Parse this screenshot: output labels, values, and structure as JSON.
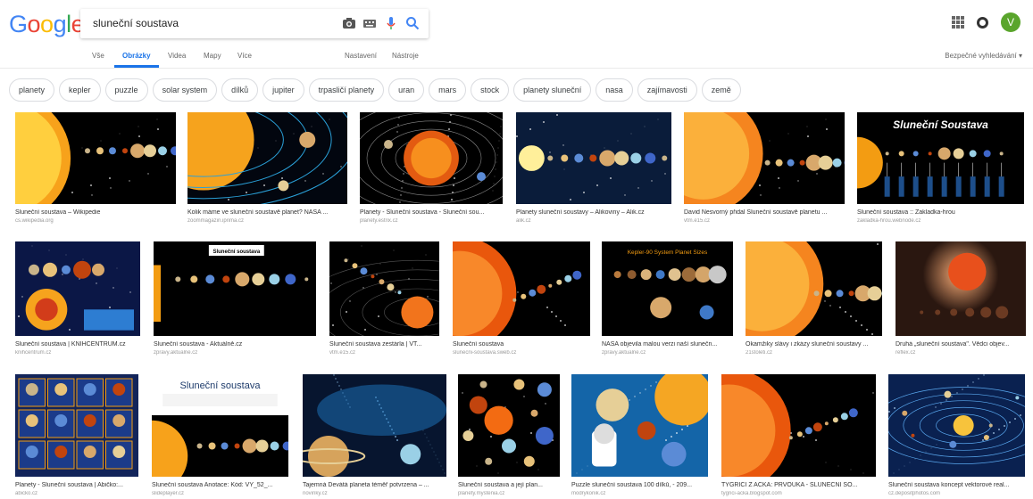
{
  "logo": {
    "letters": [
      "G",
      "o",
      "o",
      "g",
      "l",
      "e"
    ],
    "colors": [
      "#4285F4",
      "#EA4335",
      "#FBBC05",
      "#4285F4",
      "#34A853",
      "#EA4335"
    ]
  },
  "search": {
    "query": "sluneční soustava",
    "icons": [
      "camera-icon",
      "keyboard-icon",
      "microphone-icon",
      "search-icon"
    ]
  },
  "header": {
    "avatar_letter": "V",
    "accent": "#5aa52c"
  },
  "tabs": {
    "items": [
      "Vše",
      "Obrázky",
      "Videa",
      "Mapy",
      "Více"
    ],
    "active": "Obrázky",
    "settings": "Nastavení",
    "tools": "Nástroje",
    "safe_search": "Bezpečné vyhledávání ▾",
    "accent": "#1a73e8"
  },
  "chips": [
    "planety",
    "kepler",
    "puzzle",
    "solar system",
    "dílků",
    "jupiter",
    "trpasličí planety",
    "uran",
    "mars",
    "stock",
    "planety sluneční",
    "nasa",
    "zajímavosti",
    "země"
  ],
  "results": [
    {
      "title": "Sluneční soustava – Wikipedie",
      "source": "cs.wikipedia.org",
      "theme": "sun-left"
    },
    {
      "title": "Kolik máme ve sluneční soustavě planet? NASA ...",
      "source": "zoommagazin.iprima.cz",
      "theme": "sun-orbits"
    },
    {
      "title": "Planety - Sluneční soustava - Sluneční sou...",
      "source": "planety.estrix.cz",
      "theme": "sun-center"
    },
    {
      "title": "Planety sluneční soustavy – Alikoviny – Alik.cz",
      "source": "alik.cz",
      "theme": "row-planets"
    },
    {
      "title": "David Nesvorný přidal Sluneční soustavě planetu ...",
      "source": "vtm.e15.cz",
      "theme": "sun-left-big"
    },
    {
      "title": "Sluneční soustava :: Zakladka-hrou",
      "source": "zakladka-hrou.webnode.cz",
      "theme": "title-chart",
      "label": "Sluneční Soustava"
    },
    {
      "title": "Sluneční soustava | KNIHCENTRUM.cz",
      "source": "knihcentrum.cz",
      "theme": "poster"
    },
    {
      "title": "Sluneční soustava - Aktuálně.cz",
      "source": "zpravy.aktualne.cz",
      "theme": "lineup",
      "label": "Sluneční soustava"
    },
    {
      "title": "Sluneční soustava zestárla | VT...",
      "source": "vtm.e15.cz",
      "theme": "diagonal"
    },
    {
      "title": "Sluneční soustava",
      "source": "slunecni-soustava.sweb.cz",
      "theme": "sun-left-diag"
    },
    {
      "title": "NASA objevila malou verzi naší slunečn...",
      "source": "zpravy.aktualne.cz",
      "theme": "kepler",
      "label": "Kepler-90 System Planet Sizes"
    },
    {
      "title": "Okamžiky slávy i zkázy sluneční soustavy ...",
      "source": "21stoleti.cz",
      "theme": "sun-left-big"
    },
    {
      "title": "Druhá „sluneční soustava\". Vědci objev...",
      "source": "reflex.cz",
      "theme": "dark-glow"
    },
    {
      "title": "Planety - Sluneční soustava | Abičko:...",
      "source": "abicko.cz",
      "theme": "cards"
    },
    {
      "title": "Sluneční soustava Anotace: Kód: VY_52_...",
      "source": "slideplayer.cz",
      "theme": "slide",
      "label": "Sluneční soustava"
    },
    {
      "title": "Tajemná Devátá planeta téměř potvrzena – ...",
      "source": "novinky.cz",
      "theme": "blue-space"
    },
    {
      "title": "Sluneční soustava a její plan...",
      "source": "planety.mystenia.cz",
      "theme": "scatter"
    },
    {
      "title": "Puzzle sluneční soustava 100 dílků, - 209...",
      "source": "modrykonik.cz",
      "theme": "puzzle"
    },
    {
      "title": "TYGŘÍCI Z AČKA: PRVOUKA - SLUNEČNÍ SO...",
      "source": "tygrici-acka.blogspot.com",
      "theme": "sun-left-diag"
    },
    {
      "title": "Sluneční soustava koncept vektorové real...",
      "source": "cz.depositphotos.com",
      "theme": "blue-orbits"
    }
  ]
}
